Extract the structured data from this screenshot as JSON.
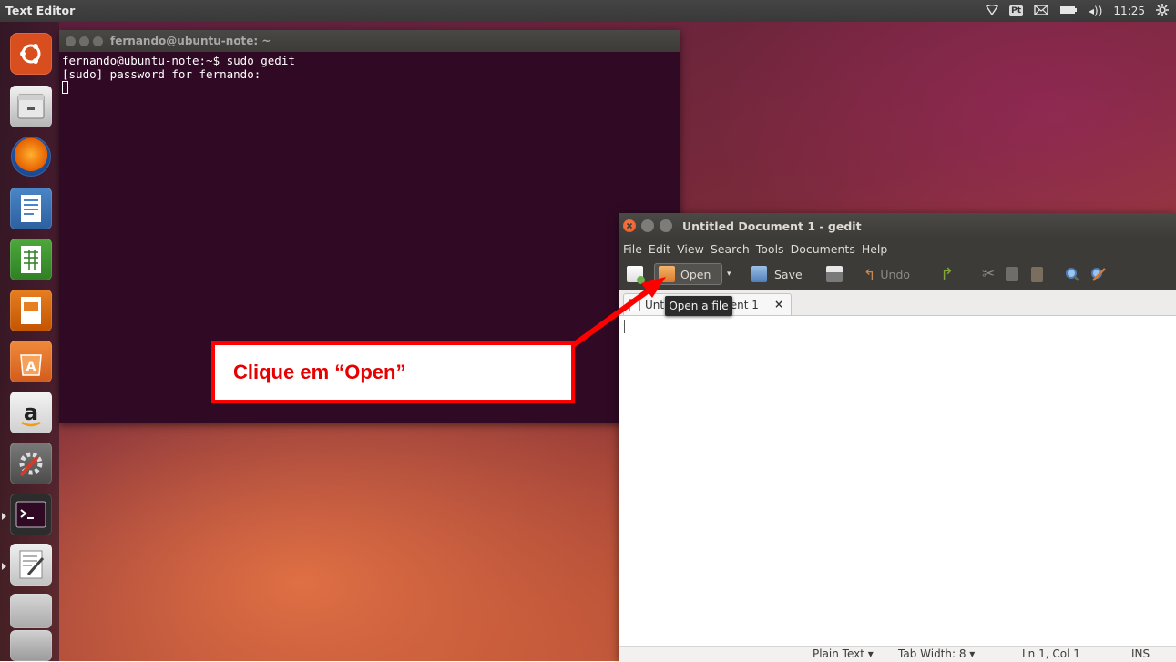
{
  "top_panel": {
    "title": "Text Editor",
    "keyboard_layout": "Pt",
    "volume": "◂))",
    "clock": "11:25"
  },
  "launcher": {
    "items": [
      "ubuntu-dash",
      "files",
      "firefox",
      "libreoffice-writer",
      "libreoffice-calc",
      "libreoffice-impress",
      "ubuntu-software-center",
      "amazon",
      "system-settings",
      "terminal",
      "text-editor",
      "workspace-switcher",
      "trash"
    ]
  },
  "terminal": {
    "title": "fernando@ubuntu-note: ~",
    "lines": [
      "fernando@ubuntu-note:~$ sudo gedit",
      "[sudo] password for fernando:"
    ]
  },
  "gedit": {
    "title": "Untitled Document 1 - gedit",
    "menu": [
      "File",
      "Edit",
      "View",
      "Search",
      "Tools",
      "Documents",
      "Help"
    ],
    "toolbar": {
      "open": "Open",
      "save": "Save",
      "undo": "Undo"
    },
    "tab_label": "Untitled Document 1",
    "tab_close": "×",
    "tooltip": "Open a file",
    "status": {
      "language": "Plain Text ▾",
      "tab_width": "Tab Width: 8 ▾",
      "position": "Ln 1, Col 1",
      "mode": "INS"
    }
  },
  "annotation": {
    "text": "Clique em “Open”"
  },
  "colors": {
    "callout_border": "#ff0000",
    "callout_text": "#e60000",
    "terminal_bg": "#300a24",
    "close_button": "#e9541e"
  }
}
